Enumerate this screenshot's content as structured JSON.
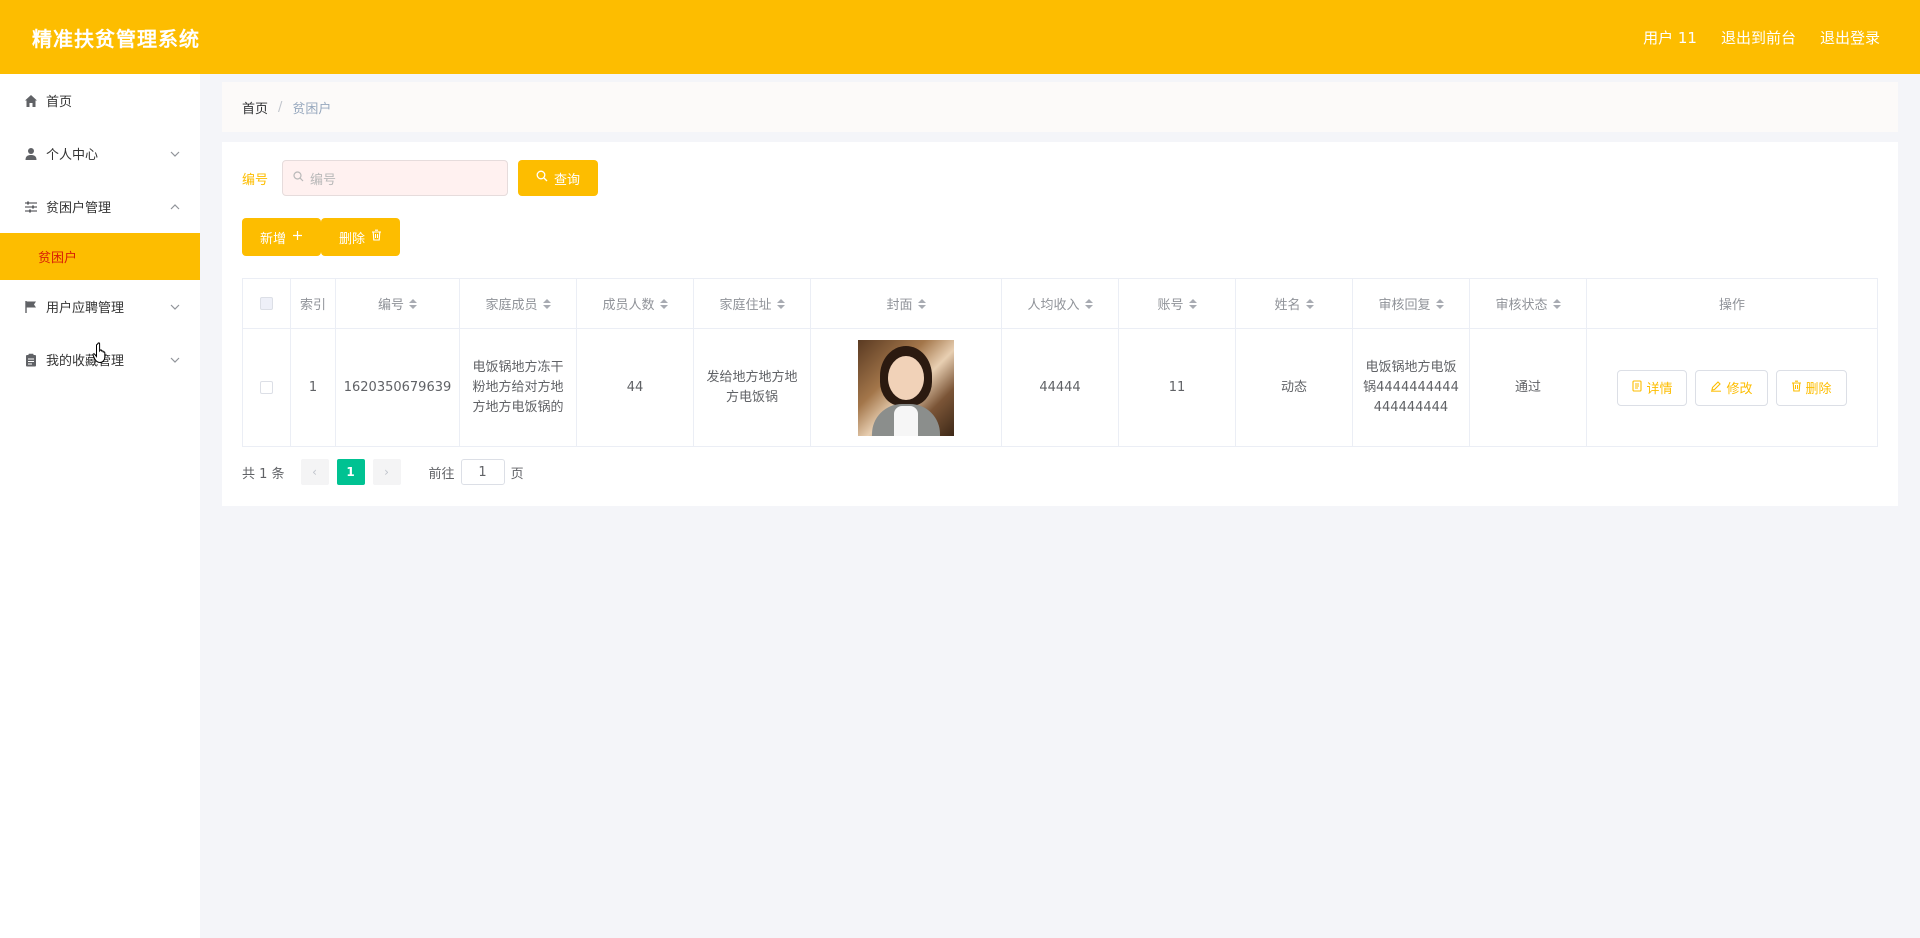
{
  "header": {
    "title": "精准扶贫管理系统",
    "user": "用户 11",
    "to_front": "退出到前台",
    "logout": "退出登录"
  },
  "sidebar": {
    "items": [
      {
        "label": "首页",
        "icon": "home-icon"
      },
      {
        "label": "个人中心",
        "icon": "user-icon"
      },
      {
        "label": "贫困户管理",
        "icon": "sliders-icon"
      },
      {
        "label": "用户应聘管理",
        "icon": "flag-icon"
      },
      {
        "label": "我的收藏管理",
        "icon": "clipboard-icon"
      }
    ],
    "sub_active": "贫困户"
  },
  "breadcrumb": {
    "home": "首页",
    "sep": "/",
    "current": "贫困户"
  },
  "search": {
    "label": "编号",
    "placeholder": "编号",
    "button": "查询"
  },
  "actions": {
    "add": "新增",
    "delete": "删除"
  },
  "table": {
    "headers": [
      "索引",
      "编号",
      "家庭成员",
      "成员人数",
      "家庭住址",
      "封面",
      "人均收入",
      "账号",
      "姓名",
      "审核回复",
      "审核状态",
      "操作"
    ],
    "rows": [
      {
        "index": "1",
        "id": "1620350679639",
        "members": "电饭锅地方冻干粉地方给对方地方地方电饭锅的",
        "count": "44",
        "address": "发给地方地方地方电饭锅",
        "income": "44444",
        "account": "11",
        "name": "动态",
        "reply": "电饭锅地方电饭锅4444444444444444444",
        "status": "通过"
      }
    ],
    "ops": {
      "detail": "详情",
      "edit": "修改",
      "delete": "删除"
    }
  },
  "pager": {
    "total": "共 1 条",
    "prev": "‹",
    "page": "1",
    "next": "›",
    "goto": "前往",
    "goto_value": "1",
    "unit": "页"
  },
  "colors": {
    "accent": "#fdbd00",
    "pager_active": "#00c292"
  }
}
